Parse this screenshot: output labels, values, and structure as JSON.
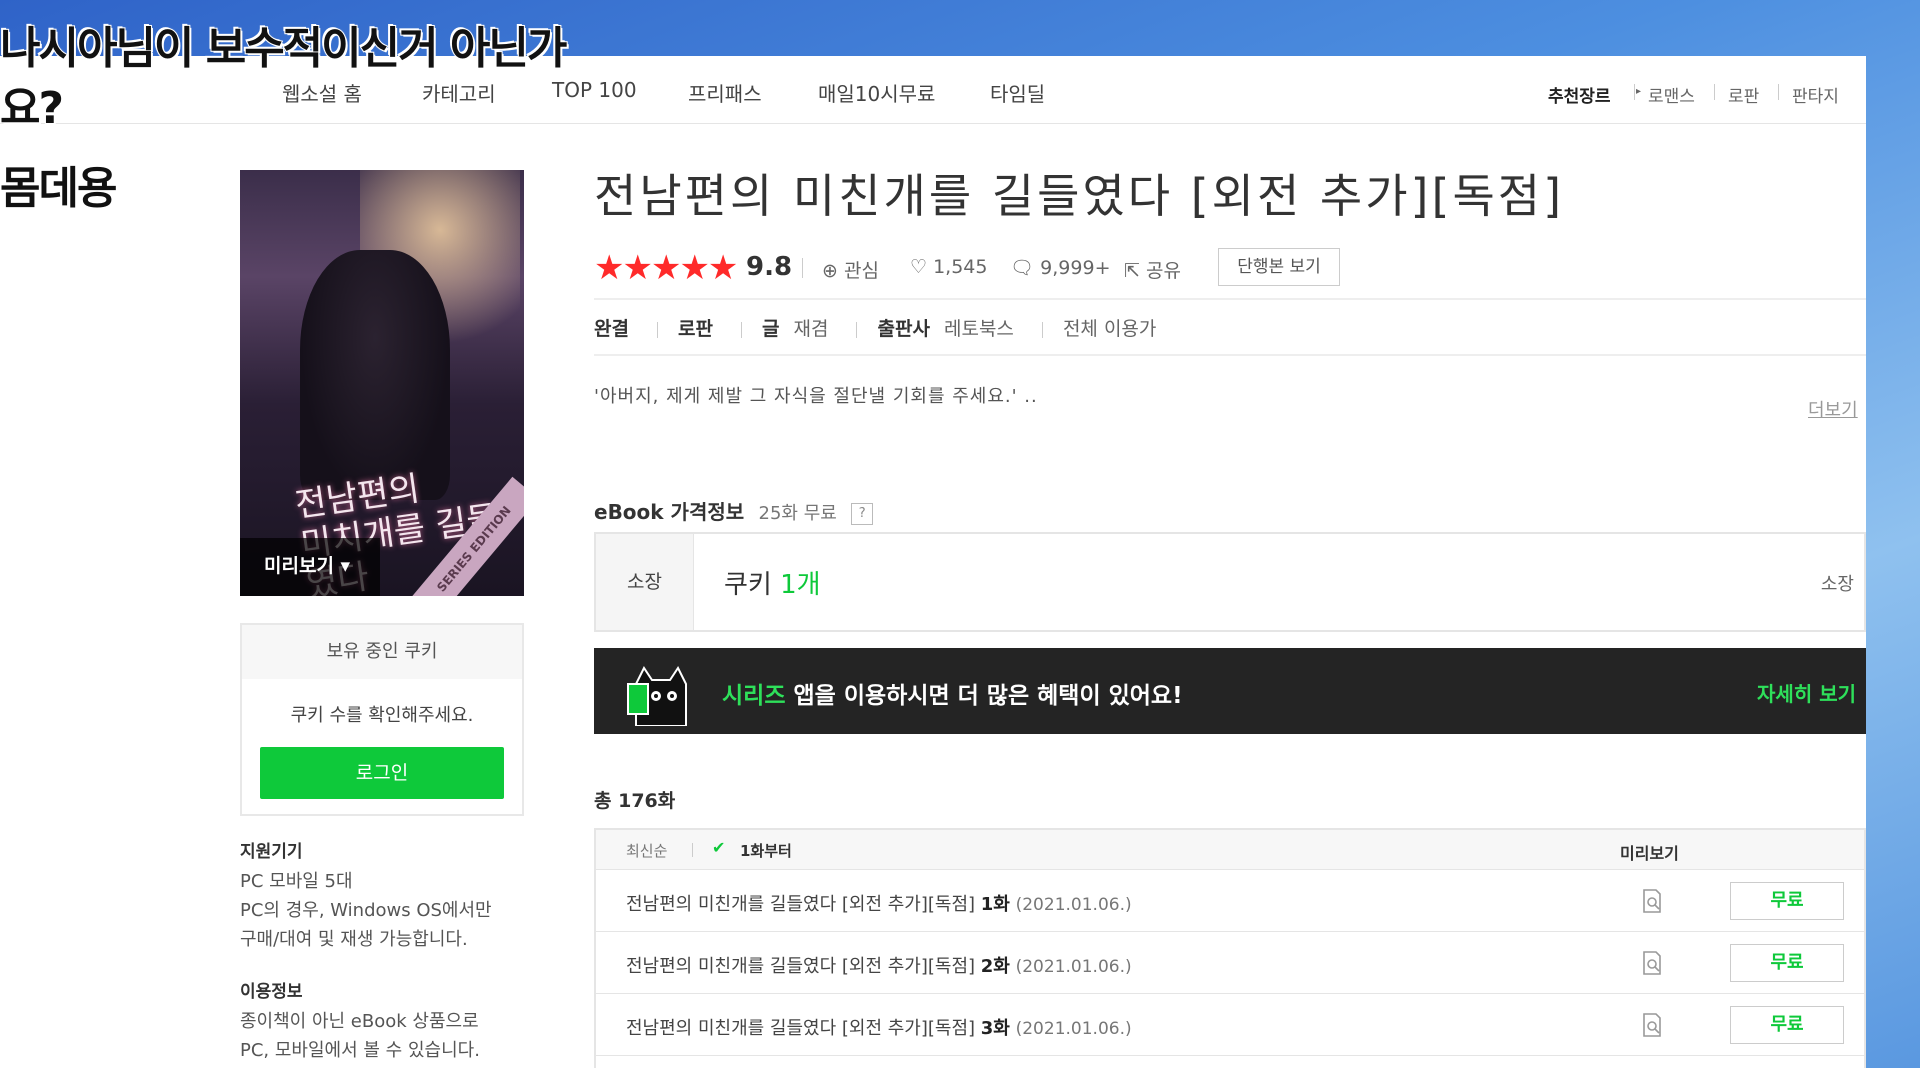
{
  "captions": [
    "나시아님이 보수적이신거 아닌가",
    "요?",
    "몸데용"
  ],
  "nav": {
    "items": [
      "웹소설 홈",
      "카테고리",
      "TOP 100",
      "프리패스",
      "매일10시무료",
      "타임딜"
    ],
    "genre_header": "추천장르",
    "genres": [
      "로맨스",
      "로판",
      "판타지"
    ]
  },
  "cover": {
    "title_lines": [
      "전남편의",
      "미치개를 길들였다"
    ],
    "preview_label": "미리보기 ▾",
    "ribbon": "SERIES EDITION"
  },
  "cookie_box": {
    "header": "보유 중인 쿠키",
    "message": "쿠키 수를 확인해주세요.",
    "login_label": "로그인"
  },
  "supported_devices": {
    "header": "지원기기",
    "lines": [
      "PC  모바일 5대",
      "PC의 경우, Windows OS에서만",
      "구매/대여 및 재생 가능합니다."
    ]
  },
  "usage_info": {
    "header": "이용정보",
    "lines": [
      "종이책이 아닌 eBook 상품으로",
      "PC, 모바일에서 볼 수 있습니다."
    ]
  },
  "book": {
    "title": "전남편의 미친개를 길들였다 [외전 추가][독점]",
    "stars": "★★★★★",
    "rating": "9.8",
    "interest_label": "관심",
    "likes": "1,545",
    "comments": "9,999+",
    "share_label": "공유",
    "single_volume_label": "단행본 보기",
    "status": "완결",
    "genre": "로판",
    "author_label": "글",
    "author": "재겸",
    "publisher_label": "출판사",
    "publisher": "레토북스",
    "age": "전체 이용가",
    "synopsis": "'아버지, 제게 제발 그 자식을 절단낼 기회를 주세요.' ..",
    "more_label": "더보기"
  },
  "price": {
    "title": "eBook 가격정보",
    "free_note": "25화 무료",
    "help": "?",
    "own_label": "소장",
    "cookie_prefix": "쿠키 ",
    "cookie_count": "1개",
    "own_right": "소장"
  },
  "banner": {
    "brand": "시리즈",
    "text": " 앱을 이용하시면 더 많은 혜택이 있어요!",
    "detail_label": "자세히 보기"
  },
  "episodes": {
    "total": "총 176화",
    "sort_latest": "최신순",
    "sort_first": "1화부터",
    "preview_header": "미리보기",
    "free_label": "무료",
    "rows": [
      {
        "title": "전남편의 미친개를 길들였다 [외전 추가][독점] ",
        "ep": "1화",
        "date": "(2021.01.06.)"
      },
      {
        "title": "전남편의 미친개를 길들였다 [외전 추가][독점] ",
        "ep": "2화",
        "date": "(2021.01.06.)"
      },
      {
        "title": "전남편의 미친개를 길들였다 [외전 추가][독점] ",
        "ep": "3화",
        "date": "(2021.01.06.)"
      }
    ]
  },
  "colors": {
    "accent_green": "#0ec93a",
    "star_red": "#ff2a2a",
    "banner_bg": "#242424"
  }
}
